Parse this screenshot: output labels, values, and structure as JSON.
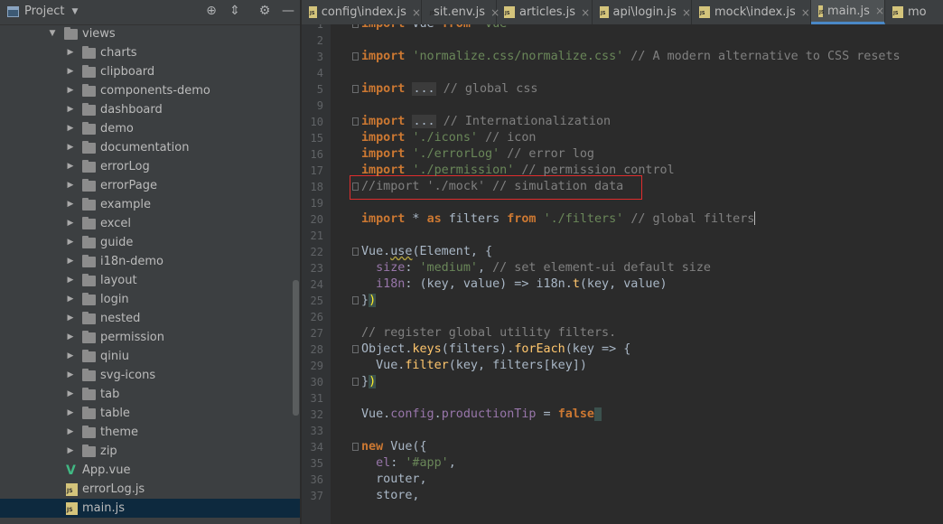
{
  "project_panel": {
    "title": "Project",
    "tree": [
      {
        "label": "views",
        "type": "folder",
        "depth": 0,
        "expanded": true
      },
      {
        "label": "charts",
        "type": "folder",
        "depth": 1
      },
      {
        "label": "clipboard",
        "type": "folder",
        "depth": 1
      },
      {
        "label": "components-demo",
        "type": "folder",
        "depth": 1
      },
      {
        "label": "dashboard",
        "type": "folder",
        "depth": 1
      },
      {
        "label": "demo",
        "type": "folder",
        "depth": 1
      },
      {
        "label": "documentation",
        "type": "folder",
        "depth": 1
      },
      {
        "label": "errorLog",
        "type": "folder",
        "depth": 1
      },
      {
        "label": "errorPage",
        "type": "folder",
        "depth": 1
      },
      {
        "label": "example",
        "type": "folder",
        "depth": 1
      },
      {
        "label": "excel",
        "type": "folder",
        "depth": 1
      },
      {
        "label": "guide",
        "type": "folder",
        "depth": 1
      },
      {
        "label": "i18n-demo",
        "type": "folder",
        "depth": 1
      },
      {
        "label": "layout",
        "type": "folder",
        "depth": 1
      },
      {
        "label": "login",
        "type": "folder",
        "depth": 1
      },
      {
        "label": "nested",
        "type": "folder",
        "depth": 1
      },
      {
        "label": "permission",
        "type": "folder",
        "depth": 1
      },
      {
        "label": "qiniu",
        "type": "folder",
        "depth": 1
      },
      {
        "label": "svg-icons",
        "type": "folder",
        "depth": 1
      },
      {
        "label": "tab",
        "type": "folder",
        "depth": 1
      },
      {
        "label": "table",
        "type": "folder",
        "depth": 1
      },
      {
        "label": "theme",
        "type": "folder",
        "depth": 1
      },
      {
        "label": "zip",
        "type": "folder",
        "depth": 1
      },
      {
        "label": "App.vue",
        "type": "vue",
        "depth": 0
      },
      {
        "label": "errorLog.js",
        "type": "js",
        "depth": 0
      },
      {
        "label": "main.js",
        "type": "js",
        "depth": 0,
        "selected": true
      }
    ]
  },
  "tabs": [
    {
      "label": "config\\index.js"
    },
    {
      "label": "sit.env.js"
    },
    {
      "label": "articles.js"
    },
    {
      "label": "api\\login.js"
    },
    {
      "label": "mock\\index.js"
    },
    {
      "label": "main.js",
      "active": true
    },
    {
      "label": "mo"
    }
  ],
  "editor": {
    "lines": [
      {
        "n": "1",
        "tokens": [
          [
            "kw",
            "import"
          ],
          [
            "plain",
            " Vue "
          ],
          [
            "kw",
            "from"
          ],
          [
            "plain",
            " "
          ],
          [
            "str",
            "'vue'"
          ]
        ],
        "fold": true
      },
      {
        "n": "2",
        "tokens": []
      },
      {
        "n": "3",
        "tokens": [
          [
            "kw",
            "import"
          ],
          [
            "plain",
            " "
          ],
          [
            "str",
            "'normalize.css/normalize.css'"
          ],
          [
            "plain",
            " "
          ],
          [
            "com",
            "// A modern alternative to CSS resets"
          ]
        ],
        "fold": true
      },
      {
        "n": "4",
        "tokens": []
      },
      {
        "n": "5",
        "tokens": [
          [
            "kw",
            "import"
          ],
          [
            "plain",
            " "
          ],
          [
            "dots",
            "..."
          ],
          [
            "plain",
            " "
          ],
          [
            "com",
            "// global css"
          ]
        ],
        "fold": true
      },
      {
        "n": "9",
        "tokens": []
      },
      {
        "n": "10",
        "tokens": [
          [
            "kw",
            "import"
          ],
          [
            "plain",
            " "
          ],
          [
            "dots",
            "..."
          ],
          [
            "plain",
            " "
          ],
          [
            "com",
            "// Internationalization"
          ]
        ],
        "fold": true
      },
      {
        "n": "15",
        "tokens": [
          [
            "kw",
            "import"
          ],
          [
            "plain",
            " "
          ],
          [
            "str",
            "'./icons'"
          ],
          [
            "plain",
            " "
          ],
          [
            "com",
            "// icon"
          ]
        ]
      },
      {
        "n": "16",
        "tokens": [
          [
            "kw",
            "import"
          ],
          [
            "plain",
            " "
          ],
          [
            "str",
            "'./errorLog'"
          ],
          [
            "plain",
            " "
          ],
          [
            "com",
            "// error log"
          ]
        ]
      },
      {
        "n": "17",
        "tokens": [
          [
            "kw",
            "import"
          ],
          [
            "plain",
            " "
          ],
          [
            "str",
            "'./permission'"
          ],
          [
            "plain",
            " "
          ],
          [
            "com",
            "// permission control"
          ]
        ]
      },
      {
        "n": "18",
        "tokens": [
          [
            "com",
            "//import './mock' // simulation data"
          ]
        ],
        "fold": true
      },
      {
        "n": "19",
        "tokens": []
      },
      {
        "n": "20",
        "tokens": [
          [
            "kw",
            "import"
          ],
          [
            "plain",
            " * "
          ],
          [
            "kw",
            "as"
          ],
          [
            "plain",
            " filters "
          ],
          [
            "kw",
            "from"
          ],
          [
            "plain",
            " "
          ],
          [
            "str",
            "'./filters'"
          ],
          [
            "plain",
            " "
          ],
          [
            "com",
            "// global filters"
          ],
          [
            "caret",
            ""
          ]
        ]
      },
      {
        "n": "21",
        "tokens": []
      },
      {
        "n": "22",
        "tokens": [
          [
            "plain",
            "Vue."
          ],
          [
            "squig",
            "use"
          ],
          [
            "plain",
            "(Element, {"
          ]
        ],
        "fold": true
      },
      {
        "n": "23",
        "tokens": [
          [
            "plain",
            "  "
          ],
          [
            "prop",
            "size"
          ],
          [
            "plain",
            ": "
          ],
          [
            "str",
            "'medium'"
          ],
          [
            "plain",
            ", "
          ],
          [
            "com",
            "// set element-ui default size"
          ]
        ]
      },
      {
        "n": "24",
        "tokens": [
          [
            "plain",
            "  "
          ],
          [
            "prop",
            "i18n"
          ],
          [
            "plain",
            ": (key, value) => i18n."
          ],
          [
            "fn",
            "t"
          ],
          [
            "plain",
            "(key, value)"
          ]
        ]
      },
      {
        "n": "25",
        "tokens": [
          [
            "plain",
            "}"
          ],
          [
            "bracehl",
            ")"
          ]
        ],
        "fold": true
      },
      {
        "n": "26",
        "tokens": []
      },
      {
        "n": "27",
        "tokens": [
          [
            "com",
            "// register global utility filters."
          ]
        ]
      },
      {
        "n": "28",
        "tokens": [
          [
            "plain",
            "Object."
          ],
          [
            "fn",
            "keys"
          ],
          [
            "plain",
            "(filters)."
          ],
          [
            "fn",
            "forEach"
          ],
          [
            "plain",
            "(key => {"
          ]
        ],
        "fold": true
      },
      {
        "n": "29",
        "tokens": [
          [
            "plain",
            "  Vue."
          ],
          [
            "fn",
            "filter"
          ],
          [
            "plain",
            "(key, filters[key])"
          ]
        ]
      },
      {
        "n": "30",
        "tokens": [
          [
            "plain",
            "}"
          ],
          [
            "bracehl",
            ")"
          ]
        ],
        "fold": true
      },
      {
        "n": "31",
        "tokens": []
      },
      {
        "n": "32",
        "tokens": [
          [
            "plain",
            "Vue."
          ],
          [
            "prop",
            "config"
          ],
          [
            "plain",
            "."
          ],
          [
            "prop",
            "productionTip"
          ],
          [
            "plain",
            " = "
          ],
          [
            "kw",
            "false"
          ],
          [
            "bracehl",
            " "
          ]
        ]
      },
      {
        "n": "33",
        "tokens": []
      },
      {
        "n": "34",
        "tokens": [
          [
            "kw",
            "new"
          ],
          [
            "plain",
            " Vue({"
          ]
        ],
        "fold": true
      },
      {
        "n": "35",
        "tokens": [
          [
            "plain",
            "  "
          ],
          [
            "prop",
            "el"
          ],
          [
            "plain",
            ": "
          ],
          [
            "str",
            "'#app'"
          ],
          [
            "plain",
            ","
          ]
        ]
      },
      {
        "n": "36",
        "tokens": [
          [
            "plain",
            "  router,"
          ]
        ]
      },
      {
        "n": "37",
        "tokens": [
          [
            "plain",
            "  store,"
          ]
        ]
      }
    ]
  }
}
